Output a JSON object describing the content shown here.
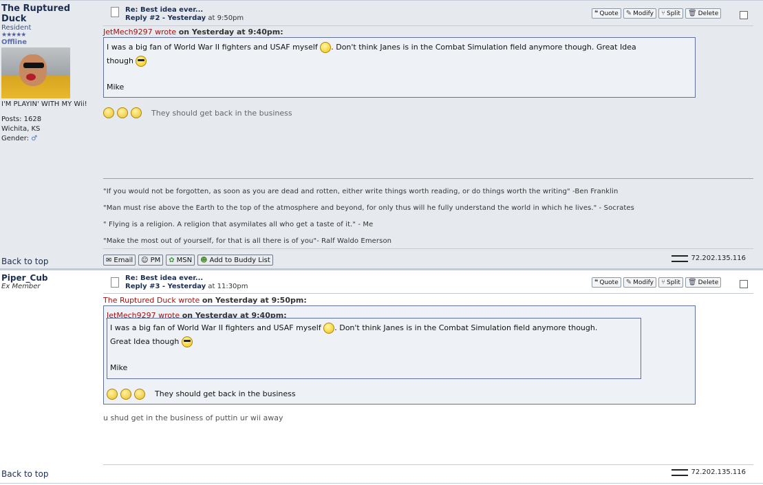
{
  "posts": [
    {
      "author": "The Ruptured Duck",
      "rank": "Resident",
      "stars": "★★★★★",
      "status": "Offline",
      "custom_text": "I'M PLAYIN' WITH MY Wii!",
      "posts_label": "Posts: 1628",
      "location": "Wichita, KS",
      "gender_label": "Gender:",
      "gender_icon": "male-icon",
      "title": "Re: Best idea ever...",
      "reply_label": "Reply #2 - Yesterday",
      "time": "at 9:50pm",
      "buttons": {
        "quote": "Quote",
        "modify": "Modify",
        "split": "Split",
        "delete": "Delete"
      },
      "quote": {
        "author": "JetMech9297",
        "wrote": "wrote",
        "when": "on Yesterday at 9:40pm:",
        "line1": "I was a big fan of World War II fighters and USAF myself",
        "line1b": ".  Don't think Janes is in the Combat Simulation field anymore though. Great Idea",
        "line2": "though",
        "sign": "Mike"
      },
      "body": "They should get back in the business",
      "signature": [
        "\"If you would not be forgotten, as soon as you are dead and rotten, either write things worth reading, or do things worth the writing\" -Ben Franklin",
        "\"Man must rise above the Earth to the top of the atmosphere and beyond, for only thus will he fully understand the world in which he lives.\" - Socrates",
        "\" Flying is a religion. A religion that asymilates all who get a taste of it.\" - Me",
        "\"Make the most out of yourself, for that is all there is of you\"- Ralf Waldo Emerson"
      ],
      "contact": {
        "email": "Email",
        "pm": "PM",
        "msn": "MSN",
        "buddy": "Add to Buddy List"
      },
      "ip": "72.202.135.116",
      "back_to_top": "Back to top"
    },
    {
      "author": "Piper_Cub",
      "rank": "Ex Member",
      "title": "Re: Best idea ever...",
      "reply_label": "Reply #3 - Yesterday",
      "time": "at 11:30pm",
      "buttons": {
        "quote": "Quote",
        "modify": "Modify",
        "split": "Split",
        "delete": "Delete"
      },
      "outer_quote": {
        "author": "The Ruptured Duck",
        "wrote": "wrote",
        "when": "on Yesterday at 9:50pm:"
      },
      "quote": {
        "author": "JetMech9297",
        "wrote": "wrote",
        "when": "on Yesterday at 9:40pm:",
        "line1": "I was a big fan of World War II fighters and USAF myself",
        "line1b": ".  Don't think Janes is in the Combat Simulation field anymore though.",
        "line2": "Great Idea though",
        "sign": "Mike"
      },
      "quoted_body": "They should get back in the business",
      "body": "u shud get in the business of puttin ur wii away",
      "ip": "72.202.135.116",
      "back_to_top": "Back to top"
    }
  ]
}
